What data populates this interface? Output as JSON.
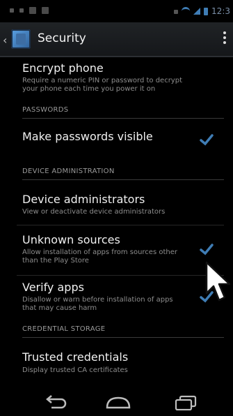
{
  "action_bar": {
    "title": "Security"
  },
  "sections": {
    "encrypt": {
      "title": "Encrypt phone",
      "summary": "Require a numeric PIN or password to decrypt your phone each time you power it on"
    },
    "passwords_header": "PASSWORDS",
    "make_visible": {
      "title": "Make passwords visible",
      "checked": true
    },
    "device_admin_header": "DEVICE ADMINISTRATION",
    "device_admins": {
      "title": "Device administrators",
      "summary": "View or deactivate device administrators"
    },
    "unknown_sources": {
      "title": "Unknown sources",
      "summary": "Allow installation of apps from sources other than the Play Store",
      "checked": true
    },
    "verify_apps": {
      "title": "Verify apps",
      "summary": "Disallow or warn before installation of apps that may cause harm",
      "checked": true
    },
    "credential_header": "CREDENTIAL STORAGE",
    "trusted_credentials": {
      "title": "Trusted credentials",
      "summary": "Display trusted CA certificates"
    }
  },
  "status_bar": {
    "time": "12:3"
  },
  "colors": {
    "accent": "#3f7db5",
    "background": "#000000"
  },
  "icons": {
    "back": "chevron-left-icon",
    "app": "security-settings-icon",
    "overflow": "overflow-menu-icon",
    "nav_back": "back-arrow-icon",
    "nav_home": "home-icon",
    "nav_recents": "recents-icon"
  }
}
